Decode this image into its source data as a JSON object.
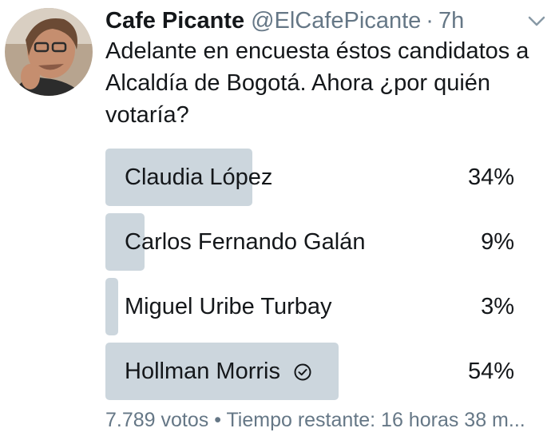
{
  "tweet": {
    "author_name": "Cafe Picante",
    "handle": "@ElCafePicante",
    "separator": "·",
    "time": "7h",
    "text": "Adelante en encuesta éstos candidatos a Alcaldía de Bogotá. Ahora ¿por quién votaría?"
  },
  "poll": {
    "options": [
      {
        "label": "Claudia López",
        "percent_text": "34%",
        "percent": 34,
        "voted": false
      },
      {
        "label": "Carlos Fernando Galán",
        "percent_text": "9%",
        "percent": 9,
        "voted": false
      },
      {
        "label": "Miguel Uribe Turbay",
        "percent_text": "3%",
        "percent": 3,
        "voted": false
      },
      {
        "label": "Hollman Morris",
        "percent_text": "54%",
        "percent": 54,
        "voted": true
      }
    ],
    "footer": "7.789 votos • Tiempo restante: 16 horas 38 m..."
  },
  "colors": {
    "bar": "#ccd6dd",
    "text": "#14171a",
    "muted": "#657786"
  },
  "icons": {
    "menu": "chevron-down-icon",
    "voted": "check-circle-icon"
  }
}
